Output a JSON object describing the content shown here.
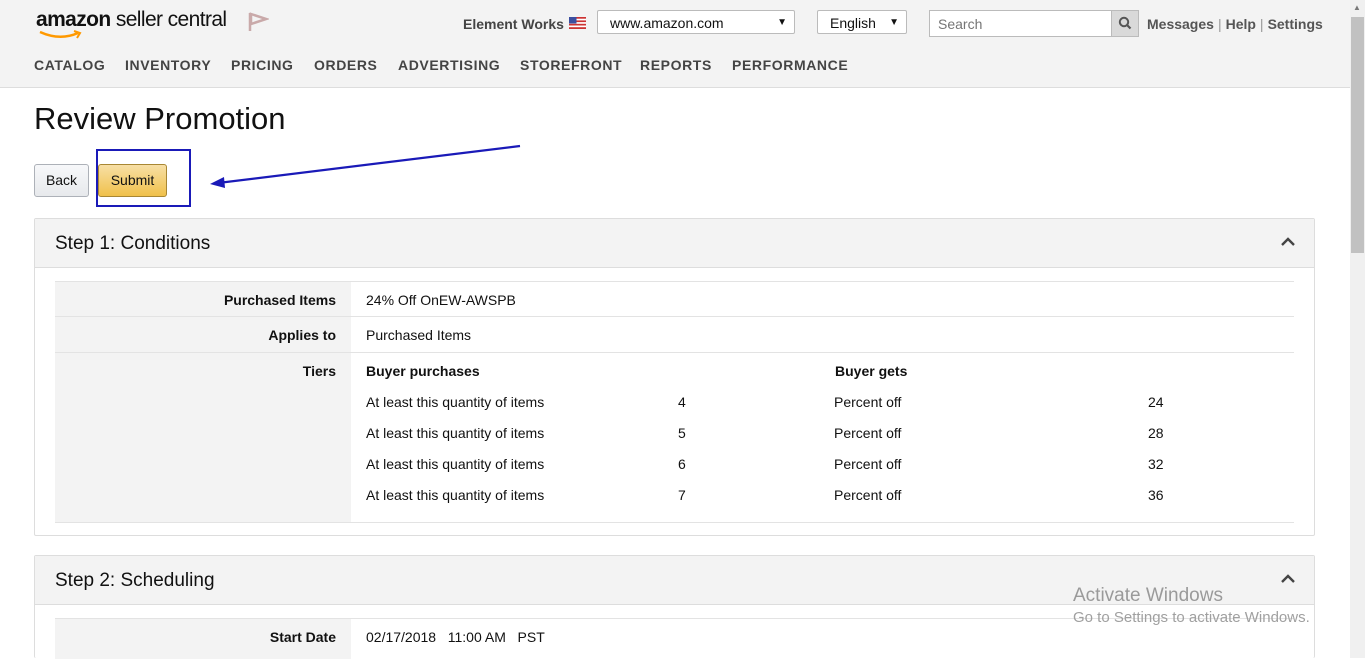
{
  "header": {
    "logo_brand": "amazon",
    "logo_product": " seller central",
    "store_name": "Element Works",
    "marketplace": "www.amazon.com",
    "language": "English",
    "search_placeholder": "Search",
    "links": [
      "Messages",
      "Help",
      "Settings"
    ]
  },
  "nav": [
    "CATALOG",
    "INVENTORY",
    "PRICING",
    "ORDERS",
    "ADVERTISING",
    "STOREFRONT",
    "REPORTS",
    "PERFORMANCE"
  ],
  "page": {
    "title": "Review Promotion",
    "back_label": "Back",
    "submit_label": "Submit"
  },
  "step1": {
    "title": "Step 1: Conditions",
    "purchased_items_label": "Purchased Items",
    "purchased_items_value": "24% Off OnEW-AWSPB",
    "applies_to_label": "Applies to",
    "applies_to_value": "Purchased Items",
    "tiers_label": "Tiers",
    "tiers_header_buy": "Buyer purchases",
    "tiers_header_get": "Buyer gets",
    "tiers": [
      {
        "cond": "At least this quantity of items",
        "qty": "4",
        "benefit": "Percent off",
        "amount": "24"
      },
      {
        "cond": "At least this quantity of items",
        "qty": "5",
        "benefit": "Percent off",
        "amount": "28"
      },
      {
        "cond": "At least this quantity of items",
        "qty": "6",
        "benefit": "Percent off",
        "amount": "32"
      },
      {
        "cond": "At least this quantity of items",
        "qty": "7",
        "benefit": "Percent off",
        "amount": "36"
      }
    ]
  },
  "step2": {
    "title": "Step 2: Scheduling",
    "start_date_label": "Start Date",
    "start_date_value": "02/17/2018   11:00 AM   PST"
  },
  "watermark": {
    "line1": "Activate Windows",
    "line2": "Go to Settings to activate Windows."
  },
  "colors": {
    "annotation": "#1a1ab8",
    "submit": "#f0c14b",
    "header_bg": "#f3f3f3"
  }
}
